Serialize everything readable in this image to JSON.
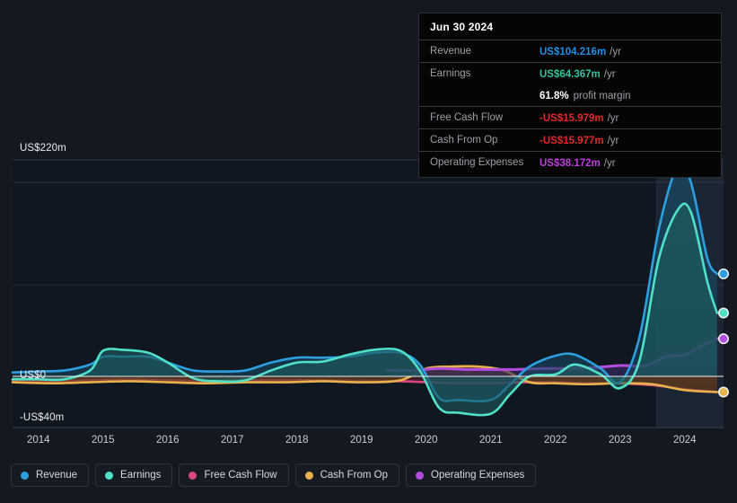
{
  "chart_data": {
    "type": "area",
    "title": "",
    "xlabel": "",
    "ylabel": "",
    "grid": true,
    "legend_position": "bottom-left",
    "ylim": [
      -40,
      220
    ],
    "xlim": [
      2013.6,
      2024.6
    ],
    "y_ticks": [
      {
        "value": 220,
        "label": "US$220m"
      },
      {
        "value": 0,
        "label": "US$0"
      },
      {
        "value": -40,
        "label": "-US$40m"
      }
    ],
    "x_ticks": [
      "2014",
      "2015",
      "2016",
      "2017",
      "2018",
      "2019",
      "2020",
      "2021",
      "2022",
      "2023",
      "2024"
    ],
    "series": [
      {
        "name": "Revenue",
        "color": "#2b9fe0",
        "fill": "#18455f",
        "x": [
          2013.6,
          2014.0,
          2014.4,
          2014.8,
          2015.0,
          2015.3,
          2015.7,
          2016.0,
          2016.4,
          2016.8,
          2017.2,
          2017.6,
          2018.0,
          2018.4,
          2018.8,
          2019.2,
          2019.6,
          2019.9,
          2020.2,
          2020.5,
          2021.0,
          2021.3,
          2021.6,
          2022.0,
          2022.3,
          2022.7,
          2023.0,
          2023.3,
          2023.6,
          2023.9,
          2024.1,
          2024.35,
          2024.5
        ],
        "values": [
          4,
          5,
          6,
          12,
          20,
          20,
          20,
          14,
          6,
          5,
          6,
          14,
          19,
          19,
          20,
          24,
          24,
          12,
          -22,
          -24,
          -24,
          -8,
          10,
          21,
          22,
          8,
          -6,
          40,
          150,
          215,
          196,
          120,
          104.216
        ]
      },
      {
        "name": "Earnings",
        "color": "#4fe0c8",
        "fill": "#1d5a5c",
        "x": [
          2013.6,
          2014.0,
          2014.4,
          2014.8,
          2015.0,
          2015.3,
          2015.7,
          2016.0,
          2016.4,
          2016.8,
          2017.2,
          2017.6,
          2018.0,
          2018.4,
          2018.8,
          2019.2,
          2019.6,
          2019.9,
          2020.2,
          2020.5,
          2021.0,
          2021.3,
          2021.6,
          2022.0,
          2022.3,
          2022.7,
          2023.0,
          2023.3,
          2023.6,
          2023.9,
          2024.1,
          2024.35,
          2024.5
        ],
        "values": [
          -3,
          -3,
          -3,
          6,
          26,
          27,
          24,
          14,
          -2,
          -5,
          -4,
          6,
          14,
          15,
          22,
          27,
          26,
          6,
          -32,
          -37,
          -38,
          -18,
          0,
          2,
          12,
          2,
          -12,
          16,
          120,
          170,
          166,
          96,
          64.367
        ]
      },
      {
        "name": "Free Cash Flow",
        "color": "#d8487f",
        "fill": "#4a1c28",
        "x": [
          2013.6,
          2014.2,
          2014.8,
          2015.4,
          2016.0,
          2016.6,
          2017.2,
          2017.8,
          2018.4,
          2019.0,
          2019.6,
          2020.0,
          2020.5,
          2021.0,
          2021.5,
          2022.0,
          2022.5,
          2023.0,
          2023.5,
          2024.0,
          2024.5
        ],
        "values": [
          -4,
          -5,
          -4,
          -3,
          -4,
          -5,
          -4,
          -4,
          -4,
          -5,
          -5,
          -6,
          -7,
          -7,
          -6,
          -6,
          -7,
          -7,
          -9,
          -13,
          -15.979
        ]
      },
      {
        "name": "Cash From Op",
        "color": "#e9b14c",
        "fill": "#5a3f1c",
        "x": [
          2013.6,
          2014.2,
          2014.8,
          2015.4,
          2016.0,
          2016.6,
          2017.2,
          2017.8,
          2018.4,
          2019.0,
          2019.6,
          2020.0,
          2020.4,
          2020.8,
          2021.2,
          2021.6,
          2022.0,
          2022.5,
          2023.0,
          2023.5,
          2024.0,
          2024.5
        ],
        "values": [
          -6,
          -7,
          -6,
          -5,
          -6,
          -7,
          -6,
          -6,
          -5,
          -6,
          -4,
          8,
          10,
          10,
          6,
          -6,
          -7,
          -8,
          -7,
          -8,
          -14,
          -15.977
        ]
      },
      {
        "name": "Operating Expenses",
        "color": "#b44ce0",
        "fill": "#3a2a63",
        "x": [
          2019.4,
          2019.8,
          2020.2,
          2020.6,
          2021.0,
          2021.4,
          2021.8,
          2022.2,
          2022.6,
          2023.0,
          2023.4,
          2023.7,
          2024.0,
          2024.25,
          2024.5
        ],
        "values": [
          6,
          6,
          8,
          7,
          7,
          7,
          8,
          8,
          9,
          11,
          11,
          20,
          22,
          31,
          38.172
        ]
      }
    ],
    "end_markers": [
      {
        "series": "Revenue",
        "value": 104.216,
        "color": "#2b9fe0"
      },
      {
        "series": "Earnings",
        "value": 64.367,
        "color": "#4fe0c8"
      },
      {
        "series": "Operating Expenses",
        "value": 38.172,
        "color": "#b44ce0"
      },
      {
        "series": "Cash From Op",
        "value": -15.977,
        "color": "#e9b14c"
      }
    ],
    "highlight_band": {
      "from": 2023.55,
      "to": 2024.6
    }
  },
  "tooltip": {
    "date": "Jun 30 2024",
    "rows": [
      {
        "label": "Revenue",
        "value": "US$104.216m",
        "unit": "/yr",
        "color": "#1f8fe8"
      },
      {
        "label": "Earnings",
        "value": "US$64.367m",
        "unit": "/yr",
        "color": "#2ec49e"
      },
      {
        "label": "",
        "value": "61.8%",
        "sub": "profit margin",
        "color": "#ffffff"
      },
      {
        "label": "Free Cash Flow",
        "value": "-US$15.979m",
        "unit": "/yr",
        "color": "#e02a2a"
      },
      {
        "label": "Cash From Op",
        "value": "-US$15.977m",
        "unit": "/yr",
        "color": "#e02a2a"
      },
      {
        "label": "Operating Expenses",
        "value": "US$38.172m",
        "unit": "/yr",
        "color": "#c23ce0"
      }
    ]
  },
  "legend": {
    "items": [
      {
        "label": "Revenue",
        "color": "#2b9fe0"
      },
      {
        "label": "Earnings",
        "color": "#4fe0c8"
      },
      {
        "label": "Free Cash Flow",
        "color": "#d8487f"
      },
      {
        "label": "Cash From Op",
        "color": "#e9b14c"
      },
      {
        "label": "Operating Expenses",
        "color": "#b44ce0"
      }
    ]
  }
}
